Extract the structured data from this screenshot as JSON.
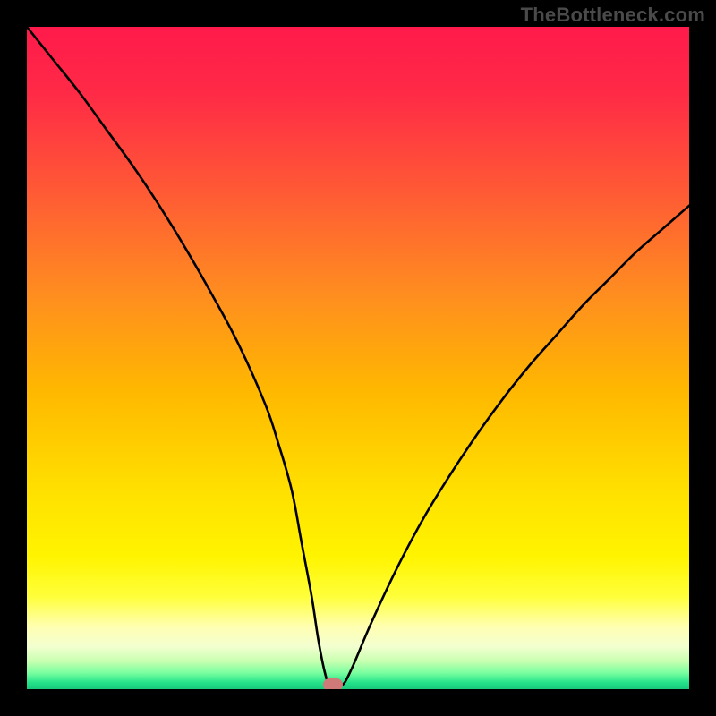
{
  "watermark": "TheBottleneck.com",
  "colors": {
    "frame": "#000000",
    "gradient_stops": [
      {
        "offset": 0.0,
        "color": "#ff1a4b"
      },
      {
        "offset": 0.1,
        "color": "#ff2a46"
      },
      {
        "offset": 0.25,
        "color": "#ff5a35"
      },
      {
        "offset": 0.4,
        "color": "#ff8c20"
      },
      {
        "offset": 0.55,
        "color": "#ffb800"
      },
      {
        "offset": 0.7,
        "color": "#ffe000"
      },
      {
        "offset": 0.8,
        "color": "#fff400"
      },
      {
        "offset": 0.86,
        "color": "#ffff3a"
      },
      {
        "offset": 0.905,
        "color": "#ffffb0"
      },
      {
        "offset": 0.935,
        "color": "#f4ffd0"
      },
      {
        "offset": 0.958,
        "color": "#c7ffb0"
      },
      {
        "offset": 0.975,
        "color": "#7bffa0"
      },
      {
        "offset": 0.99,
        "color": "#25e38a"
      },
      {
        "offset": 1.0,
        "color": "#18c97a"
      }
    ],
    "curve": "#000000",
    "marker": "#cf7a78"
  },
  "chart_data": {
    "type": "line",
    "title": "",
    "xlabel": "",
    "ylabel": "",
    "xlim": [
      0,
      100
    ],
    "ylim": [
      0,
      100
    ],
    "series": [
      {
        "name": "bottleneck-curve",
        "x": [
          0,
          4,
          8,
          12,
          16,
          20,
          24,
          28,
          32,
          36,
          38,
          40,
          41.5,
          43,
          44,
          45,
          45.8,
          47.5,
          49,
          52,
          56,
          60,
          64,
          68,
          72,
          76,
          80,
          84,
          88,
          92,
          96,
          100
        ],
        "values": [
          100,
          95,
          90,
          84.5,
          79,
          73,
          66.5,
          59.5,
          52,
          43,
          37,
          30,
          22,
          14,
          7.5,
          2.5,
          0.5,
          0.5,
          3,
          10,
          18.5,
          26,
          32.5,
          38.5,
          44,
          49,
          53.5,
          58,
          62,
          66,
          69.5,
          73
        ]
      }
    ],
    "annotations": [
      {
        "name": "optimum-marker",
        "x": 46.2,
        "y": 0.7
      }
    ]
  }
}
